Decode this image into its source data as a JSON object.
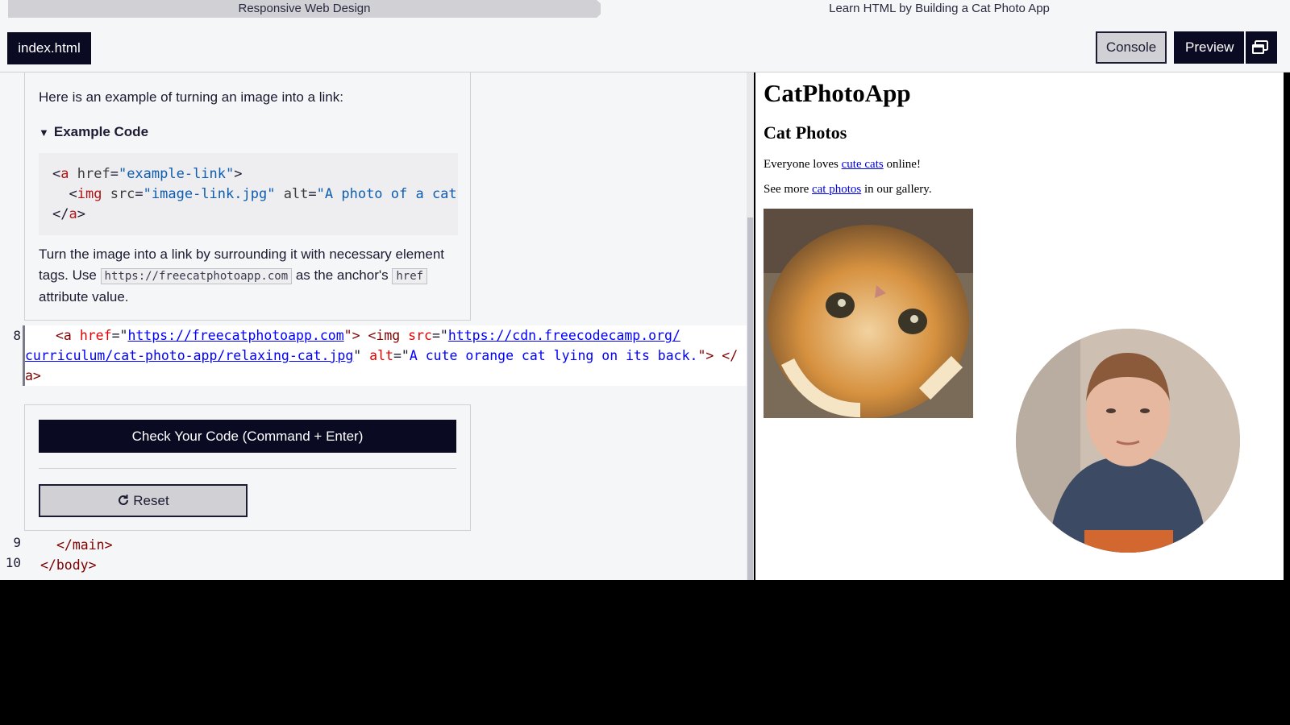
{
  "breadcrumb": {
    "course": "Responsive Web Design",
    "project": "Learn HTML by Building a Cat Photo App"
  },
  "toolbar": {
    "file_tab": "index.html",
    "console_label": "Console",
    "preview_label": "Preview",
    "preview_icon": "window-icon"
  },
  "instructions": {
    "intro": "Here is an example of turning an image into a link:",
    "details_label": "Example Code",
    "example_lines": [
      "<a href=\"example-link\">",
      "  <img src=\"image-link.jpg\" alt=\"A photo of a cat.",
      "</a>"
    ],
    "task_before": "Turn the image into a link by surrounding it with necessary element tags. Use ",
    "task_code1": "https://freecatphotoapp.com",
    "task_middle": " as the anchor's ",
    "task_code2": "href",
    "task_after": " attribute value."
  },
  "editor": {
    "line8_number": "8",
    "line8_parts": {
      "open": "<a ",
      "attr1": "href",
      "eq1": "=\"",
      "url1": "https://freecatphotoapp.com",
      "close1": "\">  <img ",
      "attr2": "src",
      "eq2": "=\"",
      "url2a": "https://cdn.freecodecamp.org/",
      "url2b": "curriculum/cat-photo-app/relaxing-cat.jpg",
      "q2": "\" ",
      "attr3": "alt",
      "eq3": "=\"",
      "alt": "A cute orange cat lying on its back.",
      "end": "\"> </",
      "end2": "a>"
    },
    "line9_number": "9",
    "line9_text": "</main>",
    "line10_number": "10",
    "line10_text": "</body>"
  },
  "actions": {
    "check_label": "Check Your Code (Command + Enter)",
    "reset_label": "Reset",
    "reset_icon": "reset-icon"
  },
  "preview": {
    "h1": "CatPhotoApp",
    "h2": "Cat Photos",
    "p1_before": "Everyone loves ",
    "p1_link": "cute cats",
    "p1_after": " online!",
    "p2_before": "See more ",
    "p2_link": "cat photos",
    "p2_after": " in our gallery.",
    "image_alt": "A cute orange cat lying on its back."
  },
  "colors": {
    "dark": "#0a0a23",
    "gray": "#d0d0d5",
    "bg": "#f5f6f7"
  }
}
